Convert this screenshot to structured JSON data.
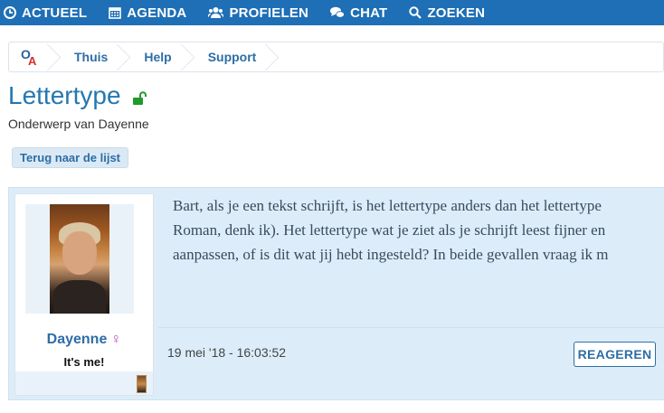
{
  "nav": {
    "items": [
      {
        "label": "ACTUEEL",
        "icon": "clock-icon"
      },
      {
        "label": "AGENDA",
        "icon": "calendar-icon"
      },
      {
        "label": "PROFIELEN",
        "icon": "users-icon"
      },
      {
        "label": "CHAT",
        "icon": "chat-bubbles-icon"
      },
      {
        "label": "ZOEKEN",
        "icon": "search-icon"
      }
    ],
    "color": "#1e6fb5"
  },
  "breadcrumb": {
    "logo_icon": "oa-logo-icon",
    "items": [
      {
        "label": "Thuis"
      },
      {
        "label": "Help"
      },
      {
        "label": "Support"
      }
    ]
  },
  "topic": {
    "title": "Lettertype",
    "lock_icon": "unlocked-padlock-icon",
    "subtitle": "Onderwerp van Dayenne",
    "back_label": "Terug naar de lijst"
  },
  "post": {
    "author": "Dayenne",
    "gender_symbol": "♀",
    "author_title": "It's me!",
    "text_lines": [
      "Bart, als je een tekst schrijft, is het lettertype anders dan het lettertype",
      "Roman, denk ik). Het lettertype wat je ziet als je schrijft leest fijner en",
      "aanpassen, of is dit wat jij hebt ingesteld? In beide gevallen vraag ik m"
    ],
    "date": "19 mei '18 - 16:03:52",
    "reply_label": "REAGEREN"
  }
}
